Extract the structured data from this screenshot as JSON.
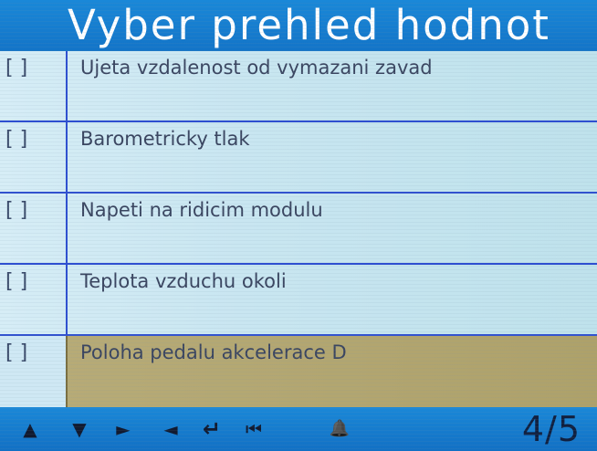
{
  "header": {
    "title": "Vyber prehled hodnot"
  },
  "items": [
    {
      "checkbox": "[ ]",
      "label": "Ujeta vzdalenost od vymazani zavad",
      "selected": false
    },
    {
      "checkbox": "[ ]",
      "label": "Barometricky tlak",
      "selected": false
    },
    {
      "checkbox": "[ ]",
      "label": "Napeti na ridicim modulu",
      "selected": false
    },
    {
      "checkbox": "[ ]",
      "label": "Teplota vzduchu okoli",
      "selected": false
    },
    {
      "checkbox": "[ ]",
      "label": "Poloha pedalu akcelerace D",
      "selected": true
    }
  ],
  "footer": {
    "keys": [
      {
        "name": "up-arrow-icon",
        "glyph": "▲"
      },
      {
        "name": "down-arrow-icon",
        "glyph": "▼"
      },
      {
        "name": "right-arrow-icon",
        "glyph": "►"
      },
      {
        "name": "left-arrow-icon",
        "glyph": "◄"
      },
      {
        "name": "enter-icon",
        "glyph": "↵"
      },
      {
        "name": "back-icon",
        "glyph": "⏮"
      },
      {
        "name": "bell-icon",
        "glyph": "🔔"
      }
    ],
    "page": "4/5"
  },
  "colors": {
    "header": "#1a88d8",
    "row_background": "#c9e6f1",
    "selected_row": "#b8ac78",
    "divider": "#2e4fd0"
  }
}
